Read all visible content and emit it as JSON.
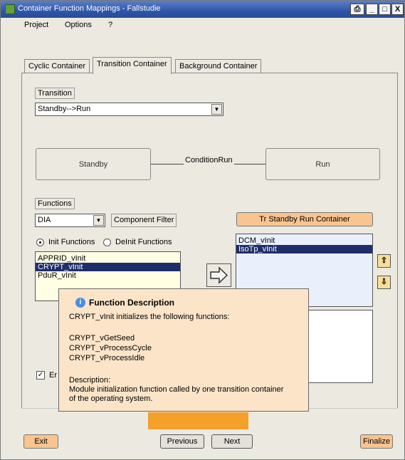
{
  "window": {
    "title": "Container Function Mappings - Fallstudie",
    "controls": {
      "print": "⎙",
      "minimize": "_",
      "maximize": "□",
      "close": "X"
    }
  },
  "menu": [
    "Project",
    "Options",
    "?"
  ],
  "tabs": [
    "Cyclic Container",
    "Transition Container",
    "Background Container"
  ],
  "transition": {
    "label": "Transition",
    "selected": "Standby-->Run"
  },
  "diagram": {
    "from_state": "Standby",
    "to_state": "Run",
    "condition": "ConditionRun"
  },
  "functions": {
    "label": "Functions",
    "filter_value": "DIA",
    "component_filter_label": "Component Filter",
    "radio_init": "Init Functions",
    "radio_deinit": "DeInit Functions",
    "available": [
      "APPRID_vInit",
      "CRYPT_vInit",
      "PduR_vInit"
    ],
    "selected_available": "CRYPT_vInit"
  },
  "container": {
    "button_label": "Tr Standby Run Container",
    "assigned": [
      "DCM_vInit",
      "IsoTp_vInit"
    ],
    "selected_assigned": "IsoTp_vInit"
  },
  "checkbox": {
    "label": "Er",
    "checked": true
  },
  "progress": {
    "fraction": 0.5
  },
  "tooltip": {
    "title": "Function Description",
    "intro": "CRYPT_vInit initializes the following functions:",
    "functions": [
      "CRYPT_vGetSeed",
      "CRYPT_vProcessCycle",
      "CRYPT_vProcessIdle"
    ],
    "description_label": "Description:",
    "description_lines": [
      "Module initialization function called by one transition container",
      "of the operating system."
    ]
  },
  "footer": {
    "exit": "Exit",
    "previous": "Previous",
    "next": "Next",
    "finalize": "Finalize"
  },
  "icons": {
    "info": "i",
    "up_arrow": "⇧",
    "down_arrow": "⇩",
    "dropdown": "▼",
    "check": "✓"
  },
  "colors": {
    "titlebar": "#2f56a8",
    "selection": "#1f2d6a",
    "tooltip_bg": "#fbe4c8",
    "progress": "#f4a02a",
    "orange_button": "#f9c490"
  }
}
